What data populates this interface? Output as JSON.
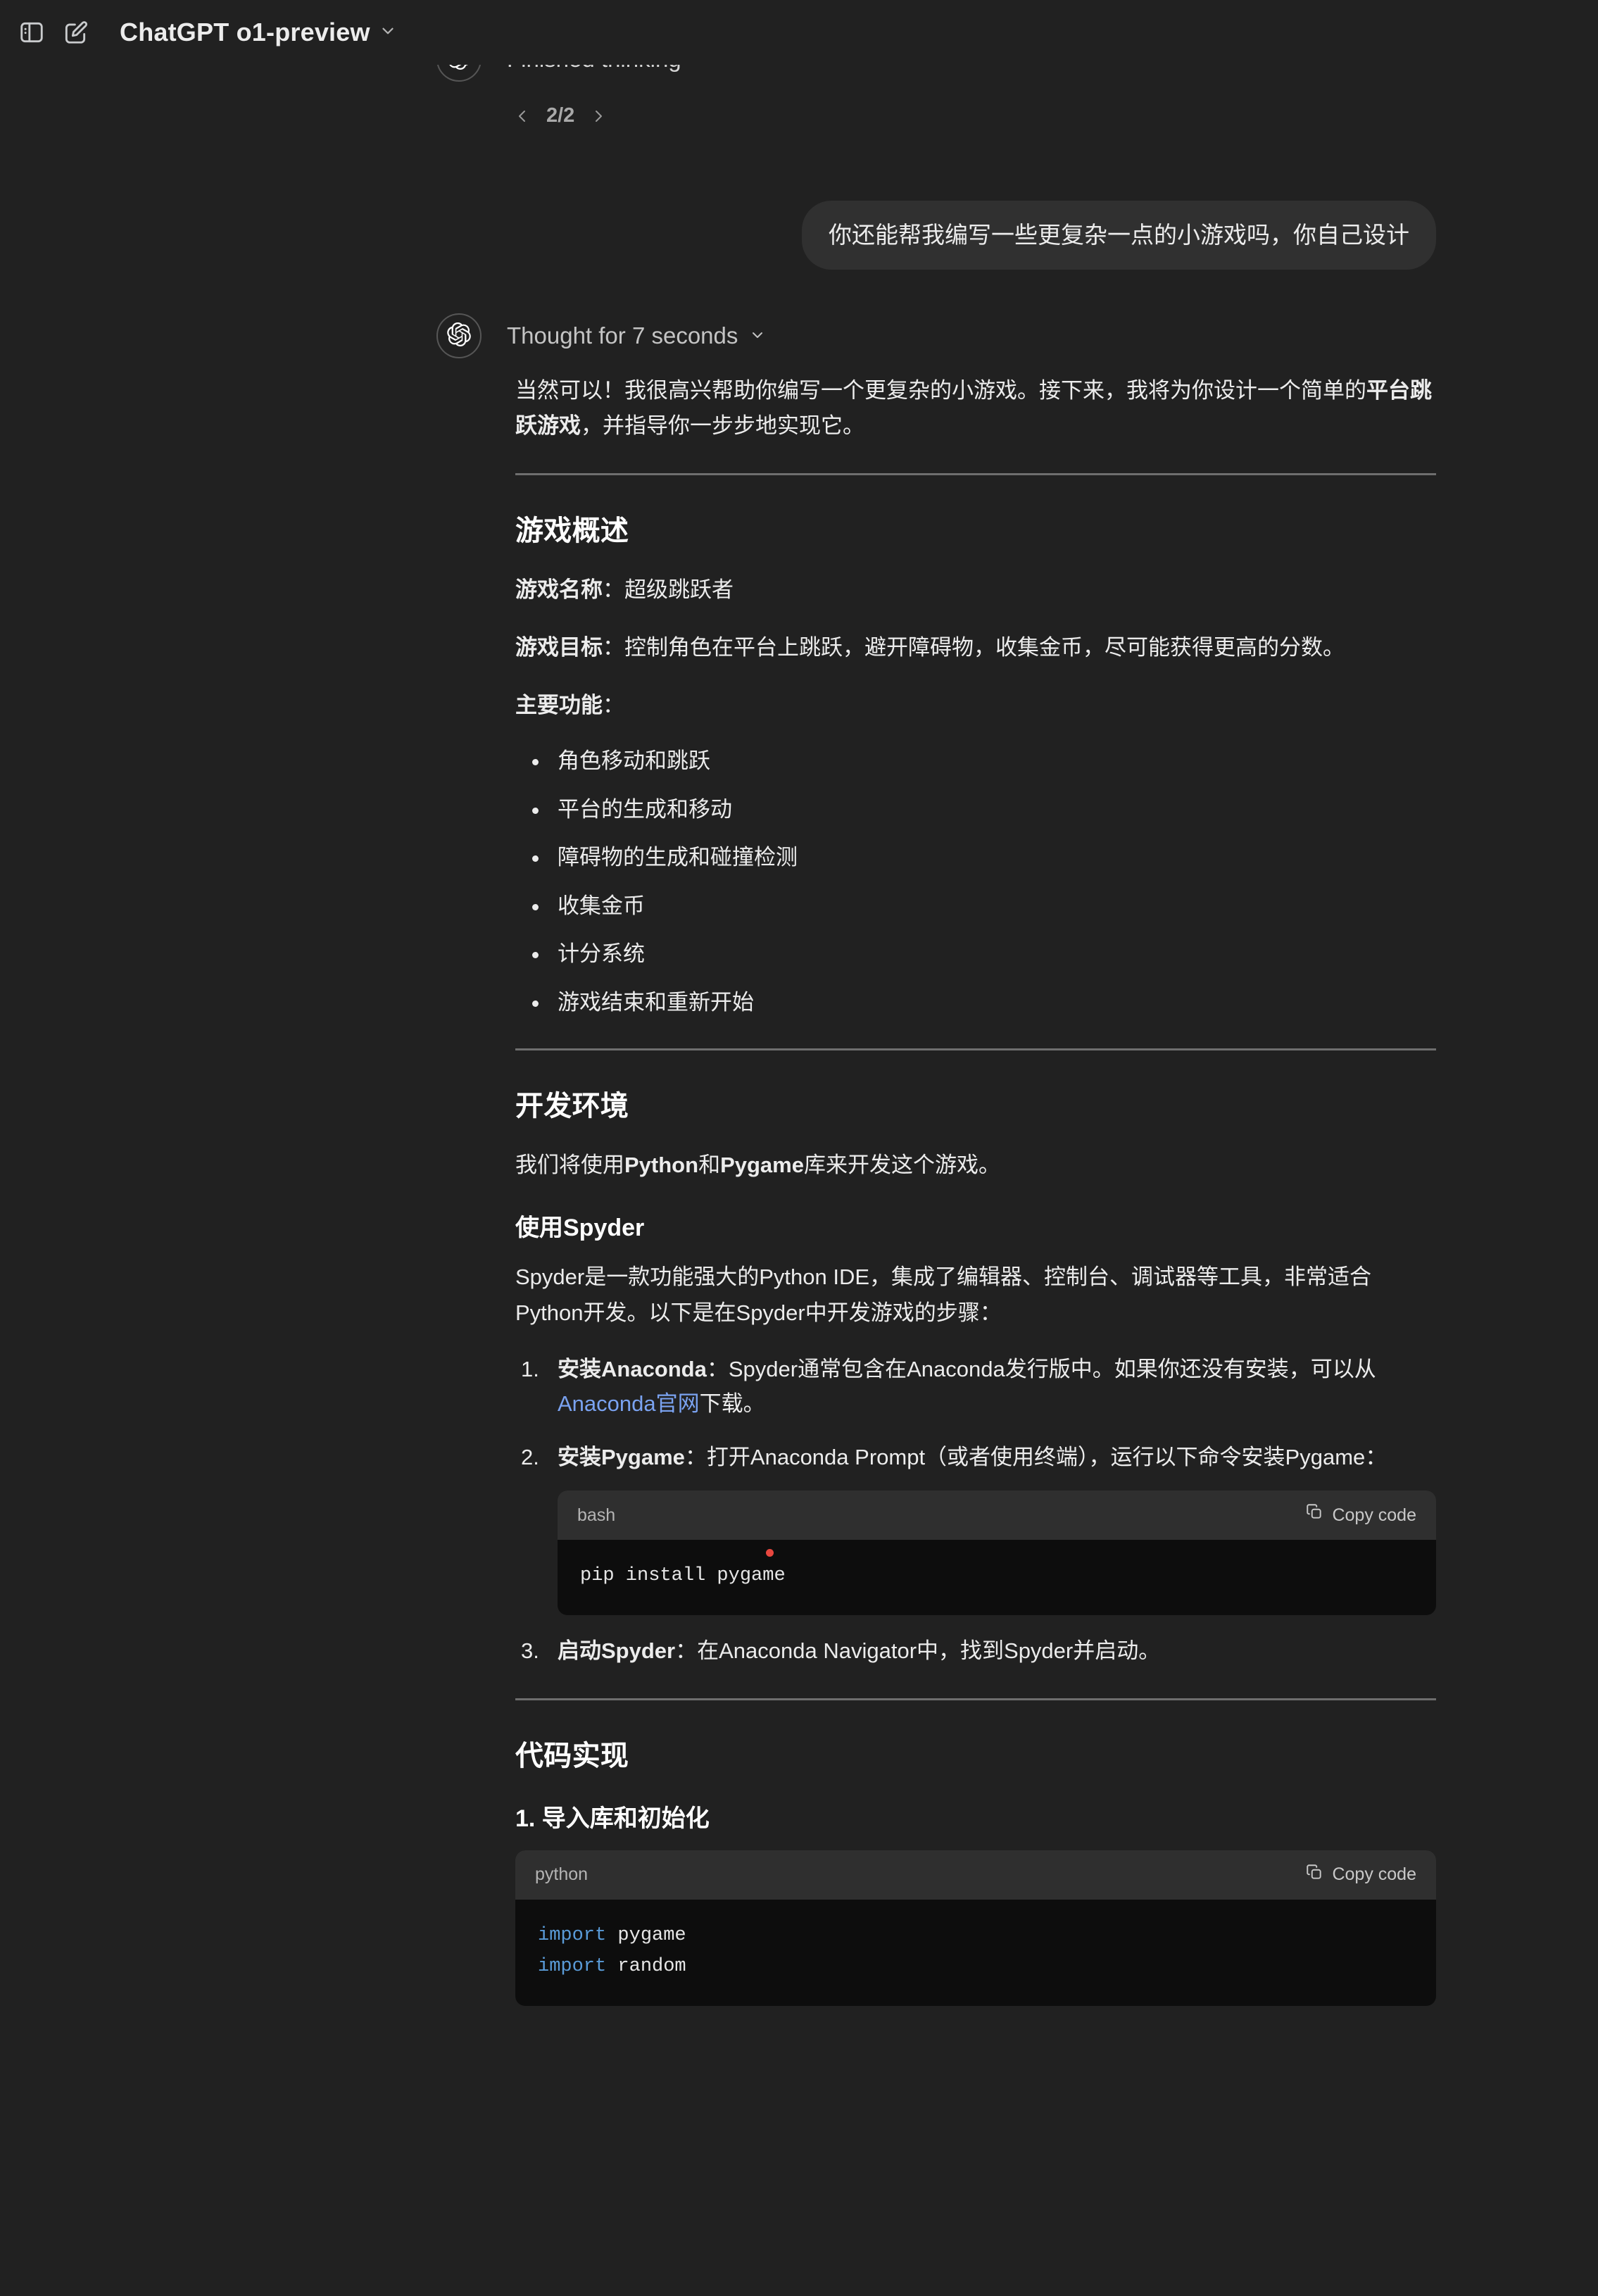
{
  "topbar": {
    "sidebar_icon": "sidebar-toggle-icon",
    "new_chat_icon": "new-chat-pencil-icon",
    "model_title": "ChatGPT o1-preview",
    "model_chevron": "chevron-down-icon"
  },
  "thinking_prev": {
    "label": "Finished thinking",
    "avatar": "openai-logo-icon"
  },
  "pagination": {
    "prev_icon": "chevron-left-icon",
    "counter": "2/2",
    "next_icon": "chevron-right-icon"
  },
  "user_message": {
    "text": "你还能帮我编写一些更复杂一点的小游戏吗，你自己设计"
  },
  "assistant": {
    "avatar": "openai-logo-icon",
    "thought_label": "Thought for 7 seconds",
    "thought_chevron": "chevron-down-icon",
    "intro": {
      "part1": "当然可以！我很高兴帮助你编写一个更复杂的小游戏。接下来，我将为你设计一个简单的",
      "bold": "平台跳跃游戏",
      "part2": "，并指导你一步步地实现它。"
    },
    "section_overview": {
      "heading": "游戏概述",
      "name_label": "游戏名称",
      "name_value": "：超级跳跃者",
      "goal_label": "游戏目标",
      "goal_value": "：控制角色在平台上跳跃，避开障碍物，收集金币，尽可能获得更高的分数。",
      "features_label": "主要功能",
      "features_colon": "：",
      "features": [
        "角色移动和跳跃",
        "平台的生成和移动",
        "障碍物的生成和碰撞检测",
        "收集金币",
        "计分系统",
        "游戏结束和重新开始"
      ]
    },
    "section_env": {
      "heading": "开发环境",
      "intro_a": "我们将使用",
      "intro_b1": "Python",
      "intro_c": "和",
      "intro_b2": "Pygame",
      "intro_d": "库来开发这个游戏。",
      "sub_heading": "使用Spyder",
      "desc": "Spyder是一款功能强大的Python IDE，集成了编辑器、控制台、调试器等工具，非常适合Python开发。以下是在Spyder中开发游戏的步骤：",
      "steps": [
        {
          "bold": "安装Anaconda",
          "text_a": "：Spyder通常包含在Anaconda发行版中。如果你还没有安装，可以从",
          "link": "Anaconda官网",
          "text_b": "下载。"
        },
        {
          "bold": "安装Pygame",
          "text_a": "：打开Anaconda Prompt（或者使用终端），运行以下命令安装Pygame：",
          "link": "",
          "text_b": ""
        },
        {
          "bold": "启动Spyder",
          "text_a": "：在Anaconda Navigator中，找到Spyder并启动。",
          "link": "",
          "text_b": ""
        }
      ],
      "bash_block": {
        "lang": "bash",
        "copy_label": "Copy code",
        "copy_icon": "copy-icon",
        "code": "pip install pygame"
      }
    },
    "section_code": {
      "heading": "代码实现",
      "sub_heading": "1. 导入库和初始化",
      "python_block": {
        "lang": "python",
        "copy_label": "Copy code",
        "copy_icon": "copy-icon",
        "lines": [
          {
            "kw": "import",
            "rest": " pygame"
          },
          {
            "kw": "import",
            "rest": " random"
          }
        ]
      }
    }
  },
  "colors": {
    "background": "#212121",
    "bubble": "#303030",
    "code_header": "#2f2f2f",
    "code_body": "#0d0d0d",
    "link": "#7aa2f0",
    "keyword": "#5a9bd8",
    "divider": "#6e6e6e"
  }
}
